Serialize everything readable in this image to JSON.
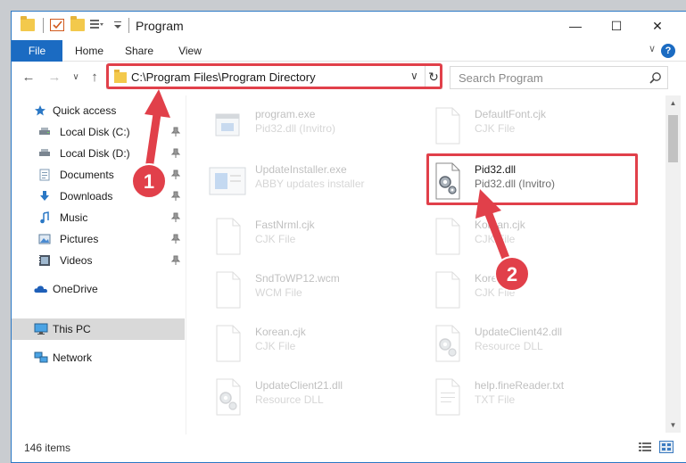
{
  "window": {
    "title": "Program"
  },
  "ribbon": {
    "tabs": [
      "File",
      "Home",
      "Share",
      "View"
    ],
    "help_label": "?"
  },
  "nav": {
    "address": "C:\\Program Files\\Program Directory",
    "search_placeholder": "Search Program"
  },
  "sidebar": {
    "quick_access": "Quick access",
    "items": [
      {
        "label": "Local Disk (C:)",
        "icon": "local-disk-icon"
      },
      {
        "label": "Local Disk (D:)",
        "icon": "local-disk-icon"
      },
      {
        "label": "Documents",
        "icon": "documents-icon"
      },
      {
        "label": "Downloads",
        "icon": "downloads-icon"
      },
      {
        "label": "Music",
        "icon": "music-icon"
      },
      {
        "label": "Pictures",
        "icon": "pictures-icon"
      },
      {
        "label": "Videos",
        "icon": "videos-icon"
      }
    ],
    "onedrive": "OneDrive",
    "this_pc": "This PC",
    "network": "Network"
  },
  "files": [
    {
      "name": "program.exe",
      "type": "Pid32.dll (Invitro)",
      "icon": "exe-icon"
    },
    {
      "name": "DefaultFont.cjk",
      "type": "CJK File",
      "icon": "file-icon"
    },
    {
      "name": "UpdateInstaller.exe",
      "type": "ABBY updates installer",
      "icon": "installer-icon"
    },
    {
      "name": "Pid32.dll",
      "type": "Pid32.dll (Invitro)",
      "icon": "dll-gear-icon"
    },
    {
      "name": "FastNrml.cjk",
      "type": "CJK File",
      "icon": "file-icon"
    },
    {
      "name": "Korean.cjk",
      "type": "CJK File",
      "icon": "file-icon"
    },
    {
      "name": "SndToWP12.wcm",
      "type": "WCM File",
      "icon": "file-icon"
    },
    {
      "name": "Korean.cjk",
      "type": "CJK File",
      "icon": "file-icon"
    },
    {
      "name": "Korean.cjk",
      "type": "CJK File",
      "icon": "file-icon"
    },
    {
      "name": "UpdateClient42.dll",
      "type": "Resource DLL",
      "icon": "dll-gear-icon"
    },
    {
      "name": "UpdateClient21.dll",
      "type": "Resource DLL",
      "icon": "dll-gear-icon"
    },
    {
      "name": "help.fineReader.txt",
      "type": "TXT File",
      "icon": "file-icon"
    }
  ],
  "status": {
    "count": "146 items"
  },
  "annotations": {
    "step1": "1",
    "step2": "2"
  },
  "colors": {
    "accent": "#1b6bc2",
    "highlight": "#e1404a",
    "selected": "#d9d9d9"
  }
}
